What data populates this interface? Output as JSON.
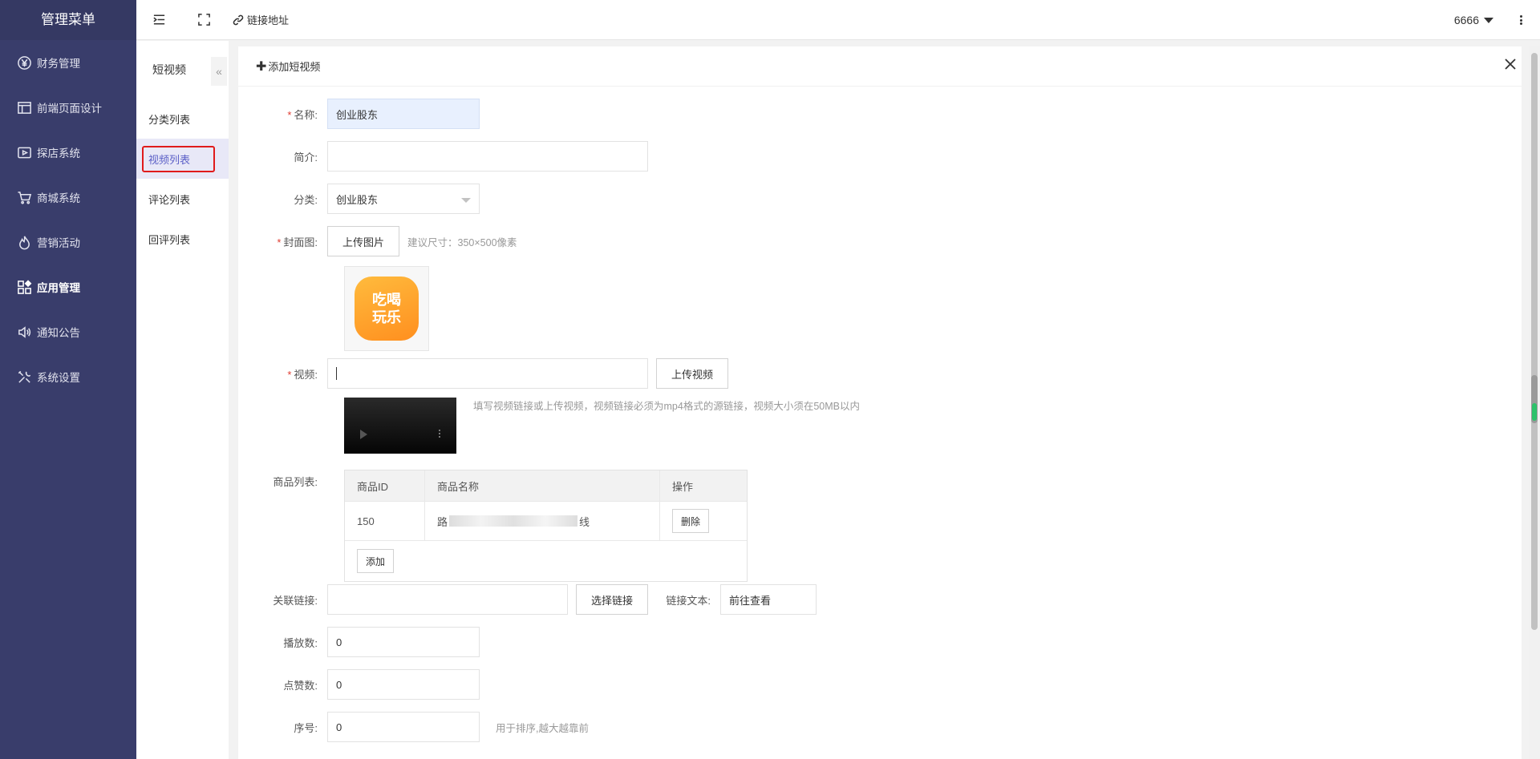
{
  "sidebar": {
    "brand": "管理菜单",
    "items": [
      {
        "label": "财务管理",
        "icon": "yen-icon"
      },
      {
        "label": "前端页面设计",
        "icon": "layout-icon"
      },
      {
        "label": "探店系统",
        "icon": "video-icon"
      },
      {
        "label": "商城系统",
        "icon": "cart-icon"
      },
      {
        "label": "营销活动",
        "icon": "fire-icon"
      },
      {
        "label": "应用管理",
        "icon": "apps-icon",
        "active": true
      },
      {
        "label": "通知公告",
        "icon": "speaker-icon"
      },
      {
        "label": "系统设置",
        "icon": "tools-icon"
      }
    ]
  },
  "header": {
    "link_label": "链接地址",
    "user": "6666"
  },
  "subnav": {
    "title": "短视频",
    "collapse": "«",
    "items": [
      {
        "label": "分类列表"
      },
      {
        "label": "视频列表",
        "active": true
      },
      {
        "label": "评论列表"
      },
      {
        "label": "回评列表"
      }
    ]
  },
  "panel": {
    "title": "添加短视频",
    "plus": "✚"
  },
  "form": {
    "name": {
      "label": "名称:",
      "value": "创业股东"
    },
    "intro": {
      "label": "简介:",
      "value": ""
    },
    "category": {
      "label": "分类:",
      "value": "创业股东"
    },
    "cover": {
      "label": "封面图:",
      "button": "上传图片",
      "hint": "建议尺寸：350×500像素",
      "image_text_1": "吃喝",
      "image_text_2": "玩乐"
    },
    "video": {
      "label": "视频:",
      "value": "",
      "button": "上传视频",
      "hint": "填写视频链接或上传视频，视频链接必须为mp4格式的源链接，视频大小须在50MB以内"
    },
    "goods": {
      "label": "商品列表:",
      "headers": [
        "商品ID",
        "商品名称",
        "操作"
      ],
      "rows": [
        {
          "id": "150",
          "name_start": "路",
          "name_end": "线",
          "action": "删除"
        }
      ],
      "add_button": "添加"
    },
    "link": {
      "label": "关联链接:",
      "value": "",
      "button": "选择链接",
      "text_label": "链接文本:",
      "text_value": "前往查看"
    },
    "plays": {
      "label": "播放数:",
      "value": "0"
    },
    "likes": {
      "label": "点赞数:",
      "value": "0"
    },
    "order": {
      "label": "序号:",
      "value": "0",
      "hint": "用于排序,越大越靠前"
    }
  }
}
